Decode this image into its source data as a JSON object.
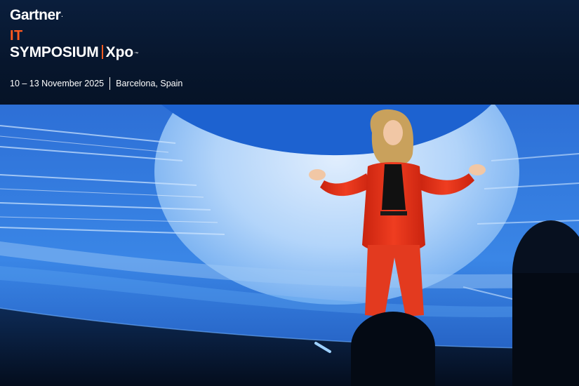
{
  "header": {
    "brand": "Gartner",
    "brand_mark": ".",
    "event_prefix": "IT",
    "event_name": "SYMPOSIUM",
    "event_suffix": "Xpo",
    "event_tm": "™",
    "date": "10 – 13 November 2025",
    "location": "Barcelona, Spain"
  },
  "colors": {
    "accent": "#ff5a1f",
    "header_bg": "#07162d",
    "stage_blue": "#2f6fd0",
    "suit_red": "#e9341c"
  },
  "hero": {
    "image": "keynote-speaker-on-stage-photo"
  }
}
